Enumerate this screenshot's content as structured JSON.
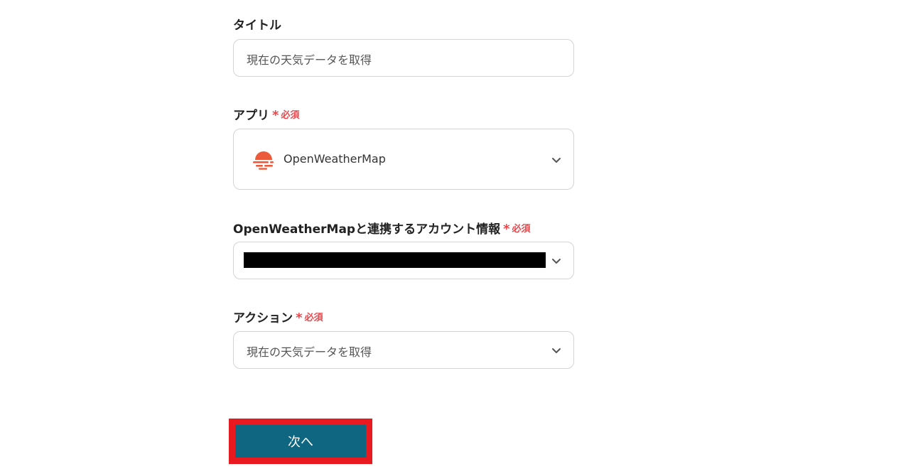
{
  "title_field": {
    "label": "タイトル",
    "value": "現在の天気データを取得"
  },
  "app_field": {
    "label": "アプリ",
    "required": "必須",
    "value": "OpenWeatherMap",
    "icon": "openweathermap-logo-icon"
  },
  "account_field": {
    "label": "OpenWeatherMapと連携するアカウント情報",
    "required": "必須",
    "value_redacted": true
  },
  "action_field": {
    "label": "アクション",
    "required": "必須",
    "value": "現在の天気データを取得"
  },
  "next_button": {
    "label": "次へ",
    "highlighted": true
  },
  "colors": {
    "required": "#e5484d",
    "button": "#0e6680",
    "highlight": "#e8191f",
    "logo": "#eb5b3b"
  }
}
